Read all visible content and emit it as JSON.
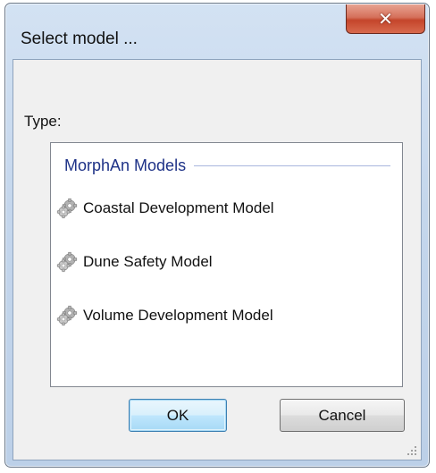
{
  "window": {
    "title": "Select model ...",
    "close_glyph": "✕"
  },
  "form": {
    "type_label": "Type:"
  },
  "list": {
    "group_title": "MorphAn Models",
    "items": [
      {
        "label": "Coastal Development Model",
        "icon": "gear-icon"
      },
      {
        "label": "Dune Safety Model",
        "icon": "gear-icon"
      },
      {
        "label": "Volume Development Model",
        "icon": "gear-icon"
      }
    ]
  },
  "buttons": {
    "ok_label": "OK",
    "cancel_label": "Cancel"
  }
}
